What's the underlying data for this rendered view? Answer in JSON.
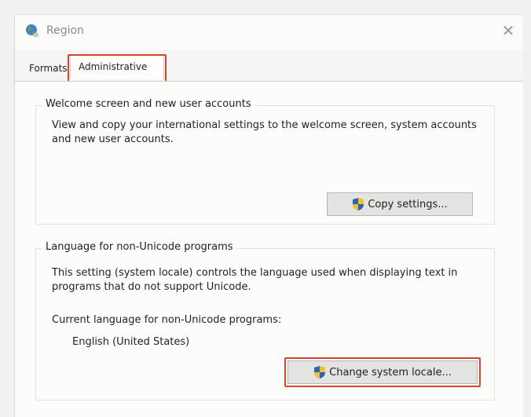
{
  "window": {
    "title": "Region",
    "close_symbol": "✕"
  },
  "tabs": [
    {
      "label": "Formats",
      "selected": false
    },
    {
      "label": "Administrative",
      "selected": true
    }
  ],
  "welcome_group": {
    "label": "Welcome screen and new user accounts",
    "description": "View and copy your international settings to the welcome screen, system accounts and new user accounts.",
    "button_label": "Copy settings...",
    "button_icon": "uac-shield-icon"
  },
  "unicode_group": {
    "label": "Language for non-Unicode programs",
    "description": "This setting (system locale) controls the language used when displaying text in programs that do not support Unicode.",
    "current_label": "Current language for non-Unicode programs:",
    "current_value": "English (United States)",
    "button_label": "Change system locale...",
    "button_icon": "uac-shield-icon"
  },
  "colors": {
    "highlight": "#d9452a",
    "shield_blue": "#2b63b8",
    "shield_yellow": "#f2c230"
  }
}
